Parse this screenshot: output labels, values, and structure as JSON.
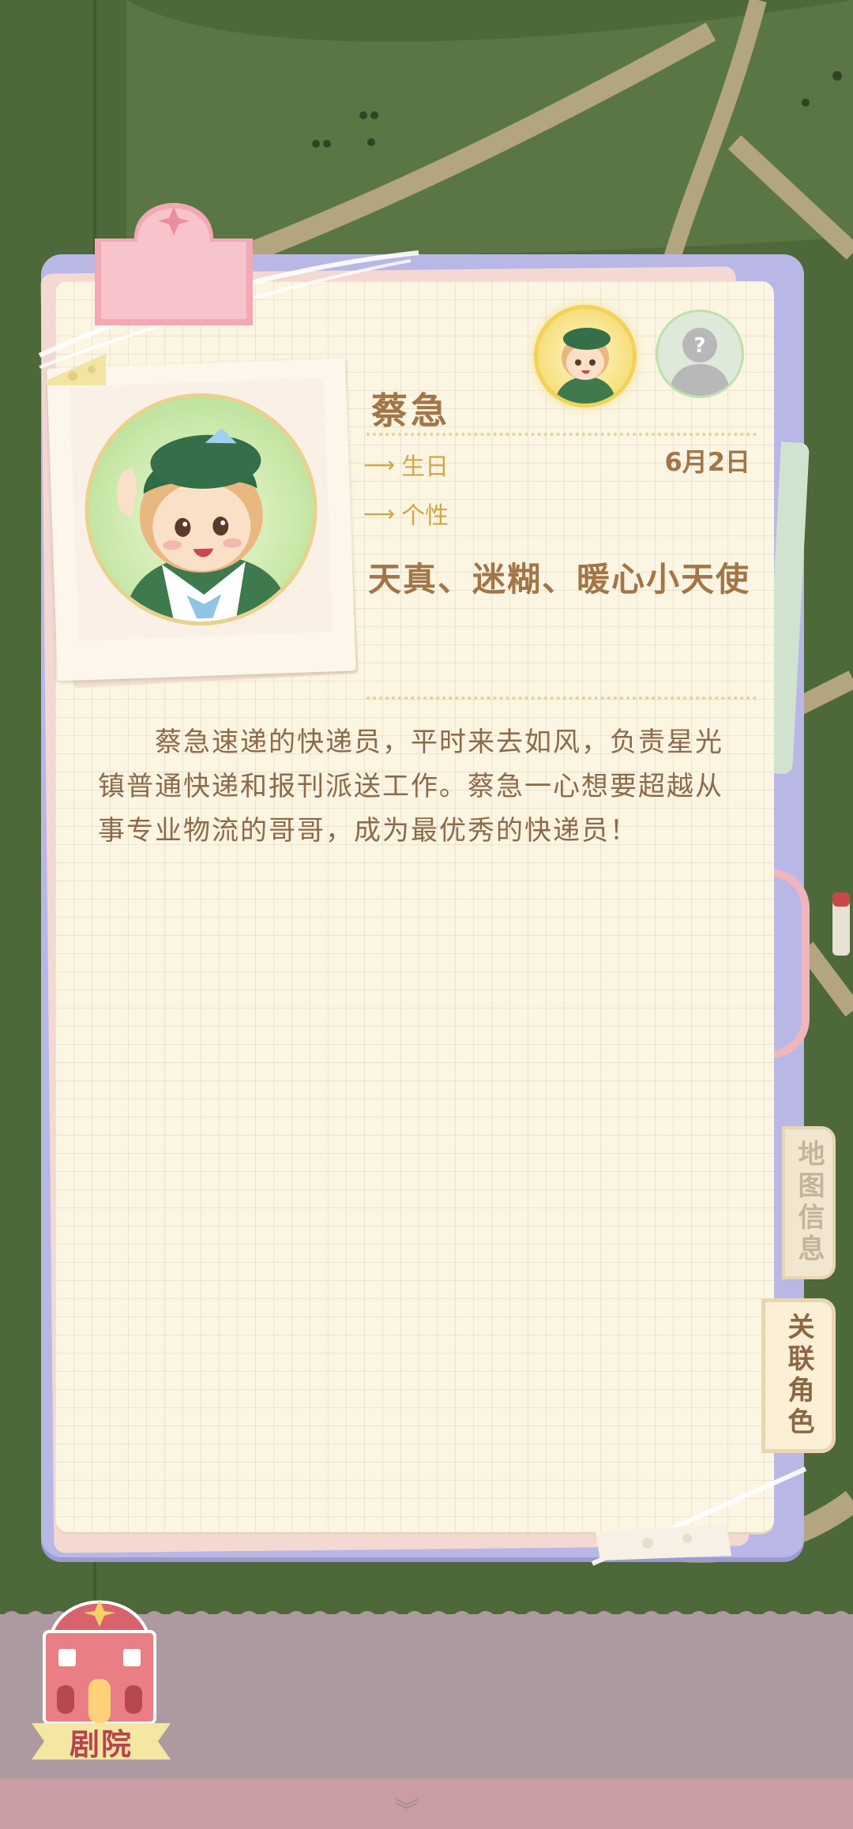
{
  "character": {
    "name": "蔡急",
    "birthday_label": "生日",
    "birthday_value": "6月2日",
    "personality_label": "个性",
    "traits": "天真、迷糊、暖心小天使",
    "description": "蔡急速递的快递员，平时来去如风，负责星光镇普通快递和报刊派送工作。蔡急一心想要超越从事专业物流的哥哥，成为最优秀的快递员！"
  },
  "avatars": {
    "unknown_mark": "?"
  },
  "side_tabs": {
    "map_info": "地图信息",
    "related_characters": "关联角色"
  },
  "bottom_nav": {
    "theater_label": "剧院"
  },
  "colors": {
    "text_brown": "#a27548",
    "label_gold": "#cfa847",
    "paper": "#fbf5e2",
    "frame_lavender": "#b9b7e6",
    "theater_red": "#b8434d"
  }
}
